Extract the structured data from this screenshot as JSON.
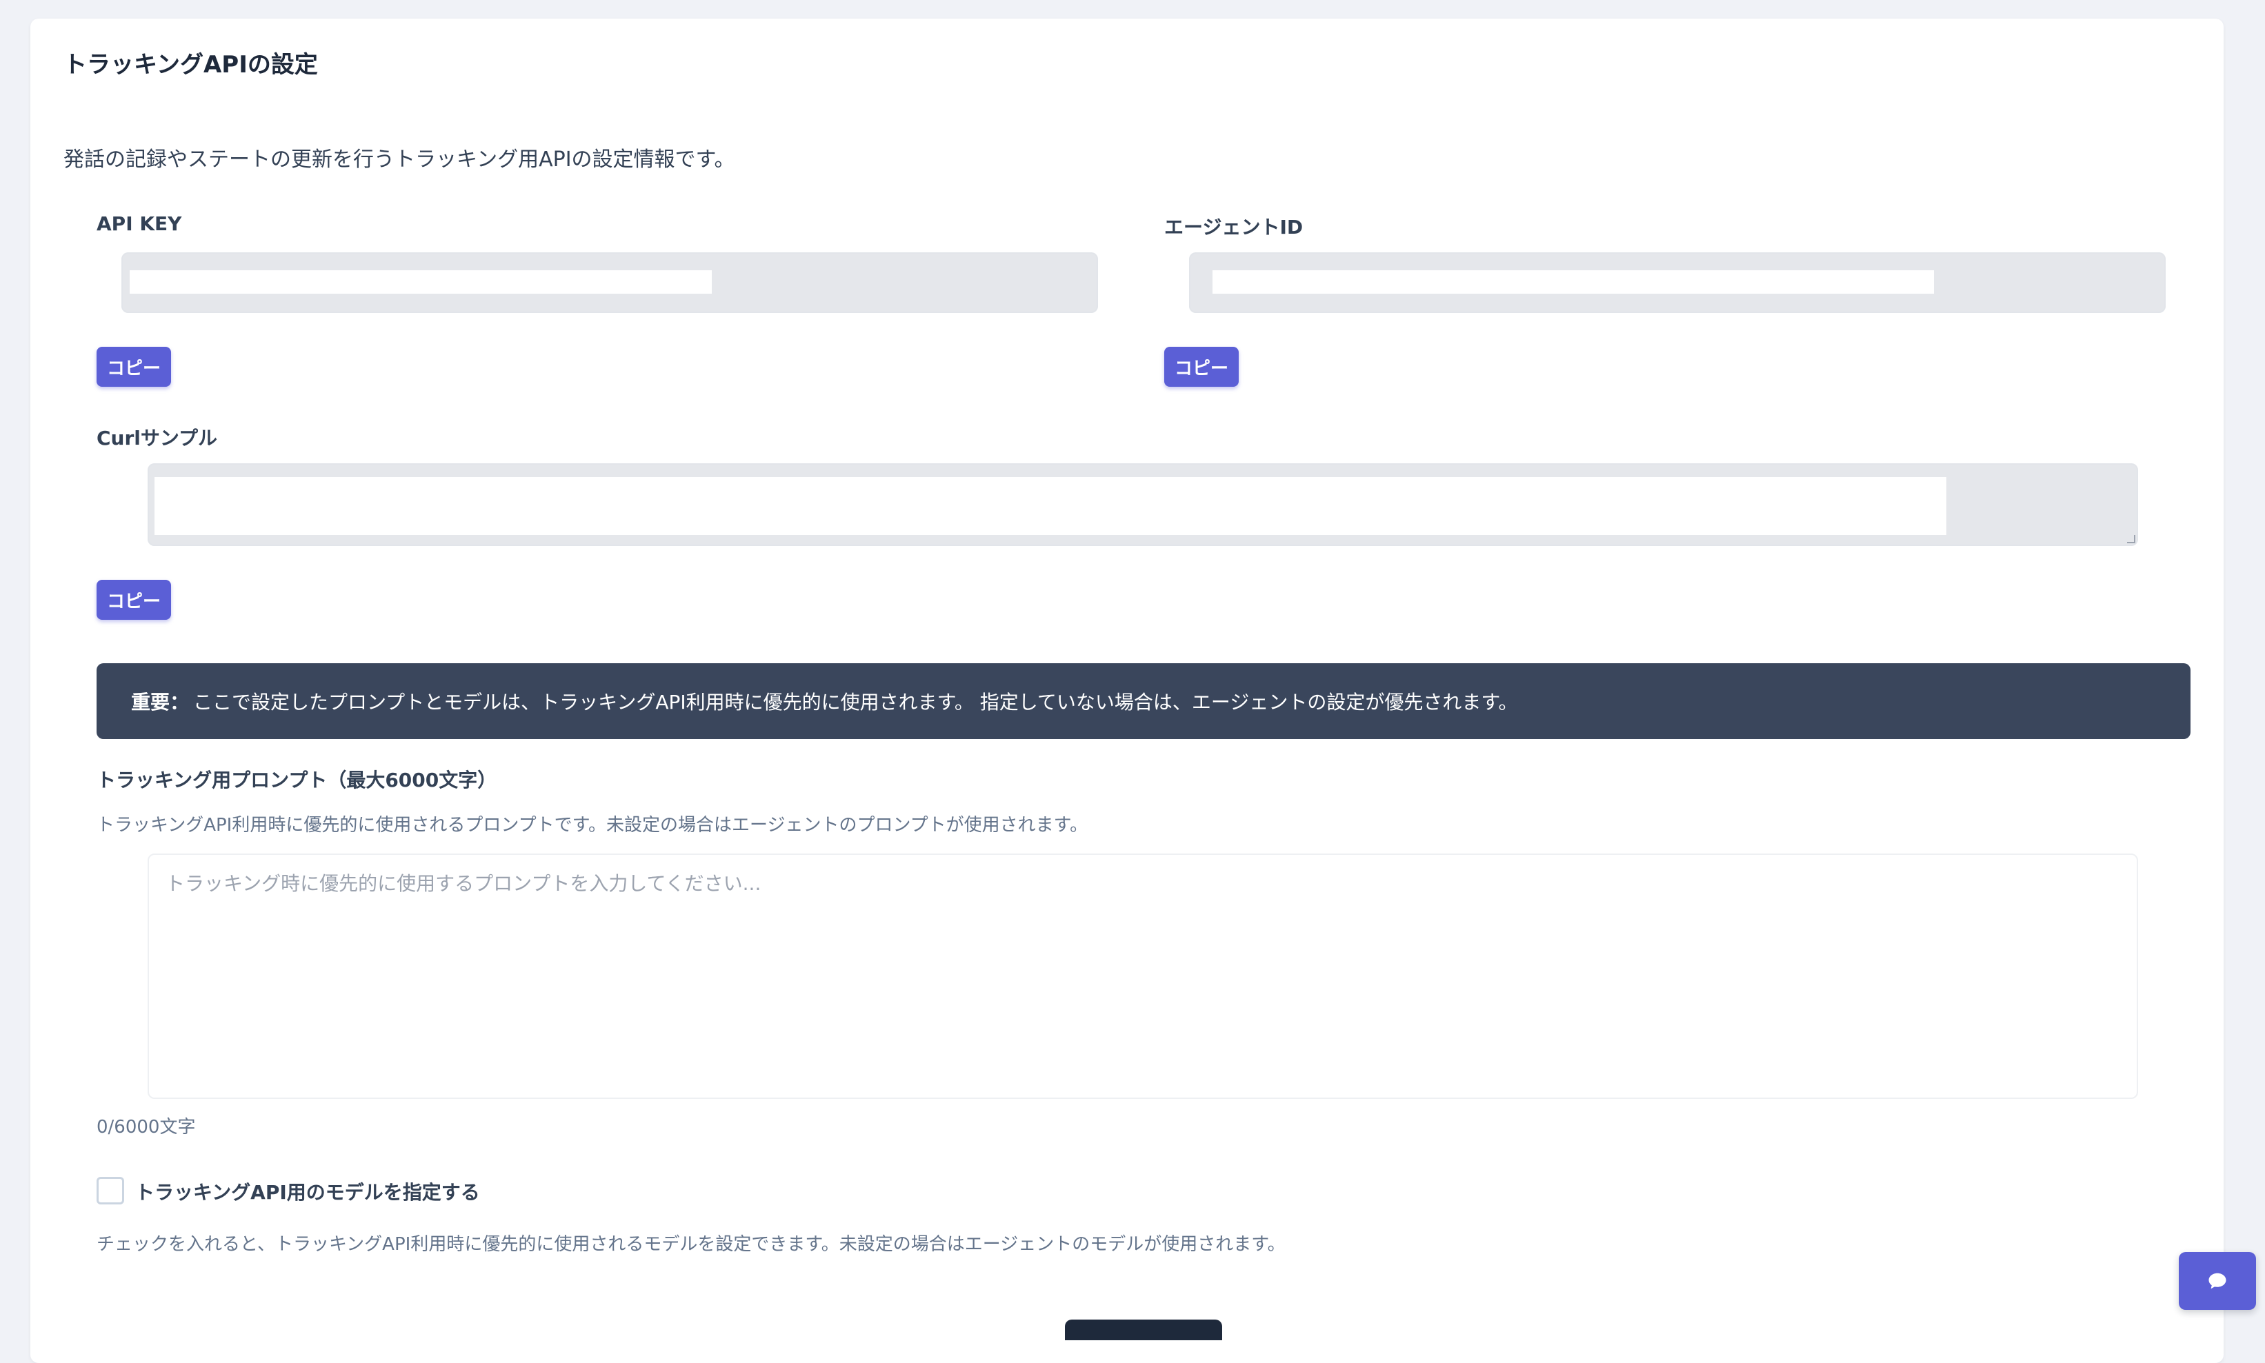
{
  "header": {
    "title": "トラッキングAPIの設定",
    "description": "発話の記録やステートの更新を行うトラッキング用APIの設定情報です。"
  },
  "api_key": {
    "label": "API KEY",
    "copy_label": "コピー"
  },
  "agent_id": {
    "label": "エージェントID",
    "copy_label": "コピー"
  },
  "curl": {
    "label": "Curlサンプル",
    "copy_label": "コピー"
  },
  "notice": {
    "strong": "重要：",
    "text": "ここで設定したプロンプトとモデルは、トラッキングAPI利用時に優先的に使用されます。 指定していない場合は、エージェントの設定が優先されます。"
  },
  "prompt": {
    "label": "トラッキング用プロンプト（最大6000文字）",
    "hint": "トラッキングAPI利用時に優先的に使用されるプロンプトです。未設定の場合はエージェントのプロンプトが使用されます。",
    "placeholder": "トラッキング時に優先的に使用するプロンプトを入力してください...",
    "counter": "0/6000文字"
  },
  "model": {
    "checkbox_label": "トラッキングAPI用のモデルを指定する",
    "hint": "チェックを入れると、トラッキングAPI利用時に優先的に使用されるモデルを設定できます。未設定の場合はエージェントのモデルが使用されます。",
    "checked": false
  },
  "colors": {
    "accent": "#5b5fd6",
    "notice_bg": "#3a465c",
    "field_bg": "#e5e7eb"
  }
}
